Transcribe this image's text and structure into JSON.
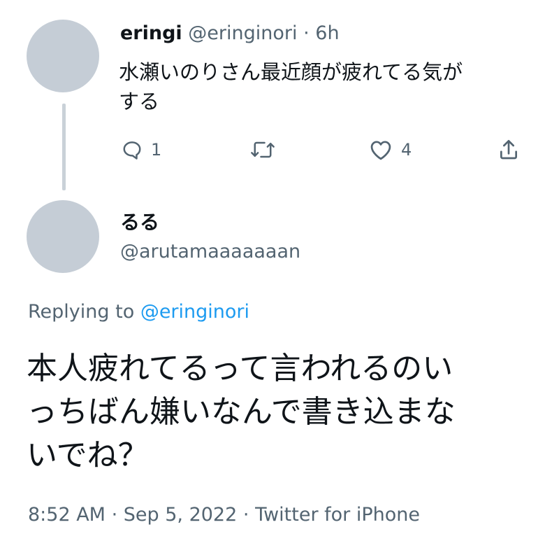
{
  "parent_tweet": {
    "display_name": "eringi",
    "handle": "@eringinori",
    "separator": "·",
    "time": "6h",
    "text_line1": "水瀬いのりさん最近顔が疲れてる気が",
    "text_line2": "する",
    "actions": {
      "reply_icon": "reply-bubble-icon",
      "reply_count": "1",
      "retweet_icon": "retweet-arrows-icon",
      "like_icon": "heart-icon",
      "like_count": "4",
      "share_icon": "share-upload-icon"
    }
  },
  "reply_tweet": {
    "display_name": "るる",
    "handle": "@arutamaaaaaaan",
    "replying_to_prefix": "Replying to",
    "replying_to_handle": "@eringinori",
    "text_line1": "本人疲れてるって言われるのい",
    "text_line2": "っちばん嫌いなんで書き込まな",
    "text_line3": "いでね？",
    "meta_time": "8:52 AM",
    "meta_sep1": "·",
    "meta_date": "Sep 5, 2022",
    "meta_sep2": "·",
    "meta_source": "Twitter for iPhone"
  },
  "colors": {
    "text": "#0f1419",
    "muted": "#536471",
    "link": "#1d9bf0",
    "avatar_placeholder": "#c5cdd6",
    "thread_line": "#c9d1d8"
  }
}
